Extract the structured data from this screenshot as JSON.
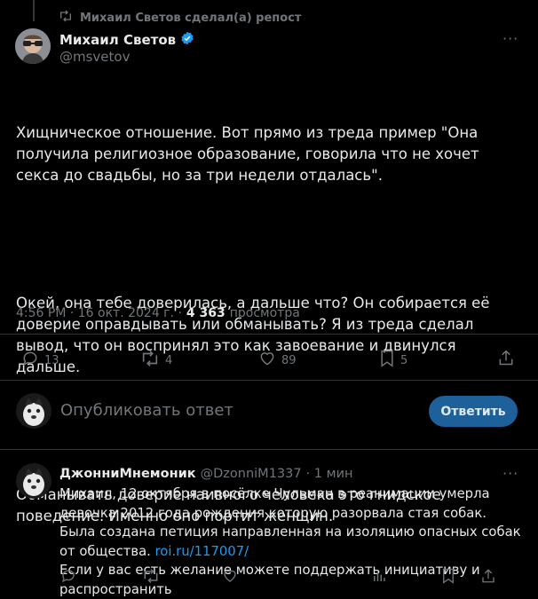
{
  "repost": {
    "text": "Михаил Светов сделал(а) репост"
  },
  "tweet": {
    "author_name": "Михаил Светов",
    "author_handle": "@msvetov",
    "paragraphs": [
      "Хищническое отношение. Вот прямо из треда пример \"Она получила религиозное образование, говорила что не хочет секса до свадьбы, но за три недели отдалась\".",
      "Окей, она тебе доверилась, а дальше что? Он собирается её доверие оправдывать или обманывать? Я из треда сделал вывод, что он воспринял это как завоевание и двинулся дальше.",
      "Обманывать доверие наивного человека это гнидское поведение. Именно оно портит женщин."
    ],
    "time": "4:56 PM · 16 окт. 2024 г. ·",
    "views_count": "4 363",
    "views_label": "просмотра",
    "actions": {
      "replies": "13",
      "reposts": "4",
      "likes": "89",
      "bookmarks": "5"
    }
  },
  "compose": {
    "placeholder": "Опубликовать ответ",
    "button": "Ответить"
  },
  "reply": {
    "author_name": "ДжонниМнемоник",
    "author_handle": "@DzonniM1337",
    "time": "· 1 мин",
    "text_before_link": "Михаил, 12 октября в посёлке Чульман в реанимации умерла девочка 2012 года рождения которую разорвала стая собак. Была создана петиция направленная на изоляцию опасных собак от общества. ",
    "link": "roi.ru/117007/",
    "text_after_link": "Если у вас есть желание можете поддержать инициативу и распространить"
  },
  "colors": {
    "accent": "#1d9bf0",
    "reply_button": "#1d609a",
    "muted": "#71767b",
    "background": "#000000"
  }
}
